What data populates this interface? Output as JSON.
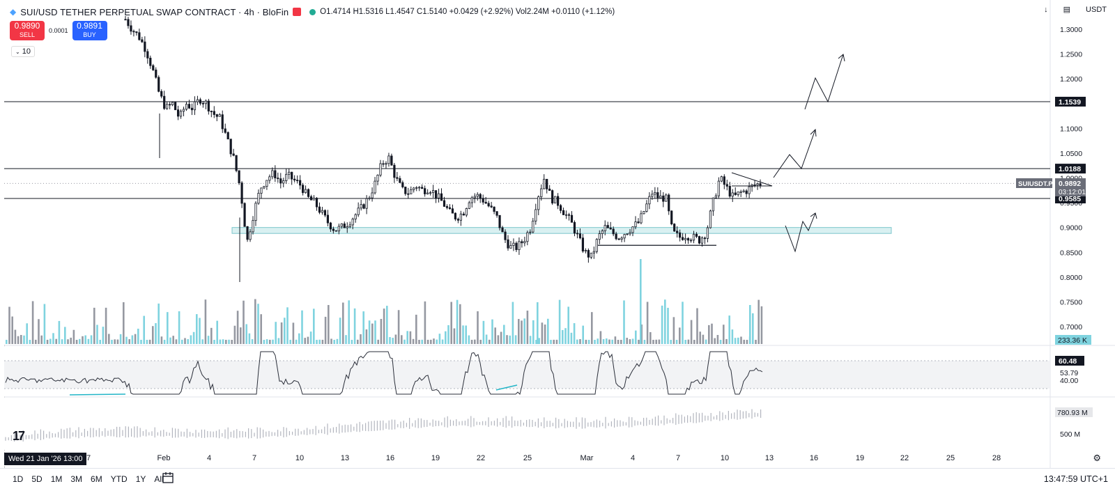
{
  "header": {
    "symbol": "SUI/USD TETHER PERPETUAL SWAP CONTRACT · 4h · BloFin",
    "ohlc": "O1.4714 H1.5316 L1.4547 C1.5140 +0.0429 (+2.92%) Vol2.24M +0.0110 (+1.12%)"
  },
  "trade": {
    "sell_price": "0.9890",
    "sell_label": "SELL",
    "spread": "0.0001",
    "buy_price": "0.9891",
    "buy_label": "BUY",
    "qty": "10"
  },
  "topright": {
    "currency": "USDT"
  },
  "colors": {
    "up": "#22ab94",
    "down": "#f23645",
    "accent": "#2962ff",
    "line": "#131722",
    "zone": "#b9e3e6"
  },
  "chart_data": [
    {
      "type": "line",
      "title": "",
      "y_ticks": [
        "1.3000",
        "1.2500",
        "1.2000",
        "1.1500",
        "1.1000",
        "1.0500",
        "1.0000",
        "0.9500",
        "0.9000",
        "0.8500",
        "0.8000",
        "0.7500",
        "0.7000"
      ],
      "ylim": [
        0.675,
        1.325
      ],
      "x_ticks": [
        "7",
        "Feb",
        "4",
        "7",
        "10",
        "13",
        "16",
        "19",
        "22",
        "25",
        "Mar",
        "4",
        "7",
        "10",
        "13",
        "16",
        "19",
        "22",
        "25",
        "28"
      ],
      "price_labels": {
        "level_high": "1.1539",
        "level_mid": "1.0188",
        "current_symbol": "SUIUSDT.P",
        "current_price": "0.9892",
        "countdown": "03:12:01",
        "level_low": "0.9585",
        "volume": "233.36 K"
      },
      "levels": [
        1.1539,
        1.0188,
        0.9585
      ],
      "demand_zone": [
        0.888,
        0.9
      ],
      "close_path": [
        1.32,
        1.3,
        1.285,
        1.26,
        1.22,
        1.17,
        1.14,
        1.15,
        1.12,
        1.15,
        1.14,
        1.16,
        1.15,
        1.13,
        1.12,
        1.08,
        1.04,
        0.98,
        0.87,
        0.93,
        0.98,
        1.0,
        1.01,
        0.99,
        1.005,
        0.995,
        0.985,
        0.96,
        0.95,
        0.93,
        0.91,
        0.895,
        0.9,
        0.91,
        0.925,
        0.94,
        0.96,
        0.99,
        1.03,
        1.04,
        1.0,
        0.975,
        0.97,
        0.985,
        0.975,
        0.98,
        0.965,
        0.95,
        0.93,
        0.92,
        0.93,
        0.96,
        0.965,
        0.955,
        0.94,
        0.92,
        0.88,
        0.86,
        0.86,
        0.875,
        0.9,
        0.96,
        1.0,
        0.96,
        0.95,
        0.93,
        0.91,
        0.88,
        0.85,
        0.84,
        0.88,
        0.9,
        0.89,
        0.88,
        0.89,
        0.9,
        0.91,
        0.94,
        0.97,
        0.96,
        0.96,
        0.89,
        0.88,
        0.885,
        0.88,
        0.875,
        0.89,
        0.95,
        1.0,
        0.98,
        0.96,
        0.97,
        0.975,
        0.985,
        0.989
      ],
      "volume_ticks_px": "see script",
      "projections": "arrows drawn as annotations"
    },
    {
      "type": "line",
      "title": "",
      "value_labels": [
        "60.48",
        "53.79",
        "40.00"
      ]
    },
    {
      "type": "line",
      "title": "",
      "value_labels": [
        "780.93 M",
        "500 M"
      ]
    }
  ],
  "footer": {
    "ranges": [
      "1D",
      "5D",
      "1M",
      "3M",
      "6M",
      "YTD",
      "1Y",
      "All"
    ],
    "crosshair_date": "Wed 21 Jan '26   13:00",
    "clock": "13:47:59 UTC+1"
  }
}
